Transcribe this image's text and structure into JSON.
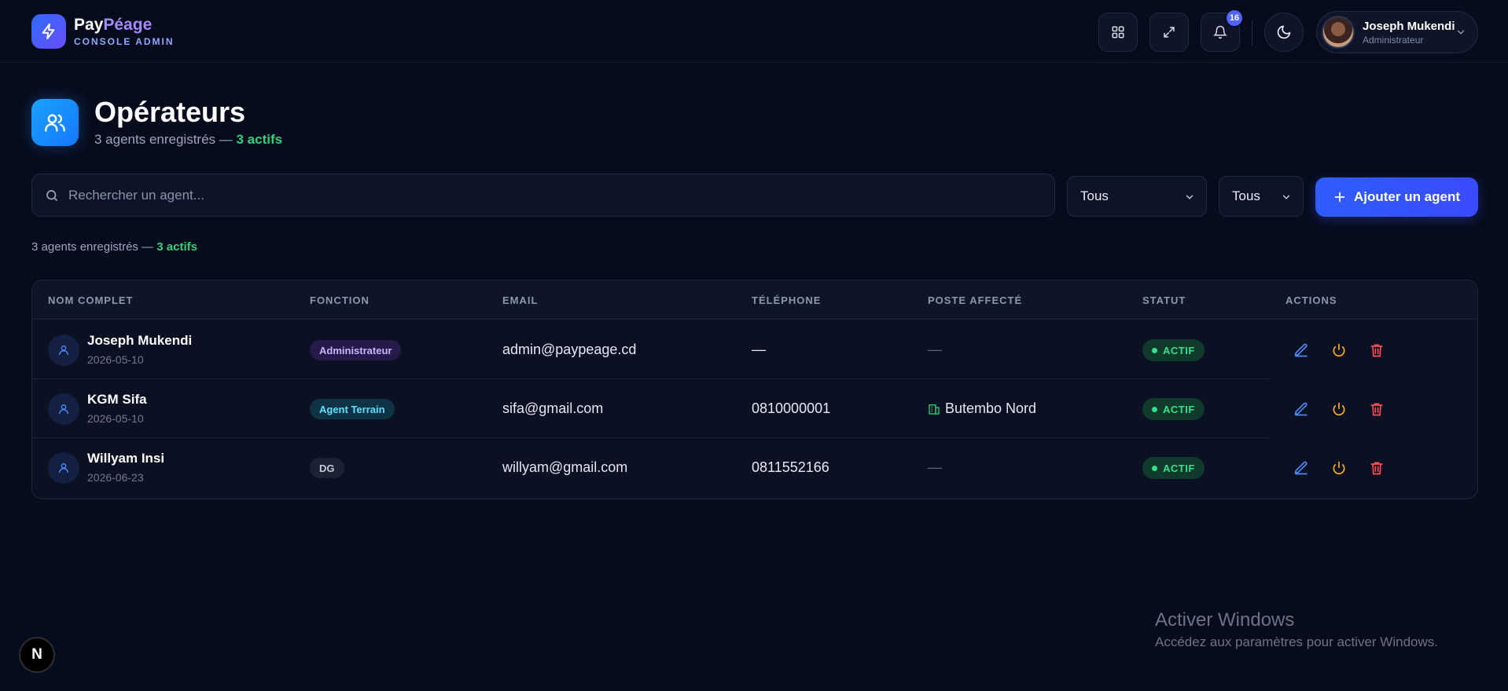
{
  "brand": {
    "name_part1": "Pay",
    "name_part2": "Péage",
    "subtitle": "CONSOLE ADMIN"
  },
  "header": {
    "notification_count": "16",
    "user": {
      "name": "Joseph Mukendi",
      "role": "Administrateur"
    }
  },
  "page": {
    "title": "Opérateurs",
    "subtitle_prefix": "3 agents enregistrés — ",
    "subtitle_active": "3 actifs"
  },
  "toolbar": {
    "search_placeholder": "Rechercher un agent...",
    "filter1_value": "Tous",
    "filter2_value": "Tous",
    "add_label": "Ajouter un agent"
  },
  "summary": {
    "prefix": "3 agents enregistrés — ",
    "active": "3 actifs"
  },
  "table": {
    "columns": [
      "NOM COMPLET",
      "FONCTION",
      "EMAIL",
      "TÉLÉPHONE",
      "POSTE AFFECTÉ",
      "STATUT",
      "ACTIONS"
    ],
    "rows": [
      {
        "name": "Joseph Mukendi",
        "date": "2026-05-10",
        "fonction": "Administrateur",
        "email": "admin@paypeage.cd",
        "phone": "—",
        "poste": "—",
        "statut": "ACTIF"
      },
      {
        "name": "KGM Sifa",
        "date": "2026-05-10",
        "fonction": "Agent Terrain",
        "email": "sifa@gmail.com",
        "phone": "0810000001",
        "poste": "Butembo Nord",
        "statut": "ACTIF"
      },
      {
        "name": "Willyam Insi",
        "date": "2026-06-23",
        "fonction": "DG",
        "email": "willyam@gmail.com",
        "phone": "0811552166",
        "poste": "—",
        "statut": "ACTIF"
      }
    ]
  },
  "watermark": {
    "line1": "Activer Windows",
    "line2": "Accédez aux paramètres pour activer Windows."
  },
  "dev_button": "N",
  "colors": {
    "accent": "#2f5dff",
    "success": "#35e08a",
    "background": "#070c1c"
  }
}
